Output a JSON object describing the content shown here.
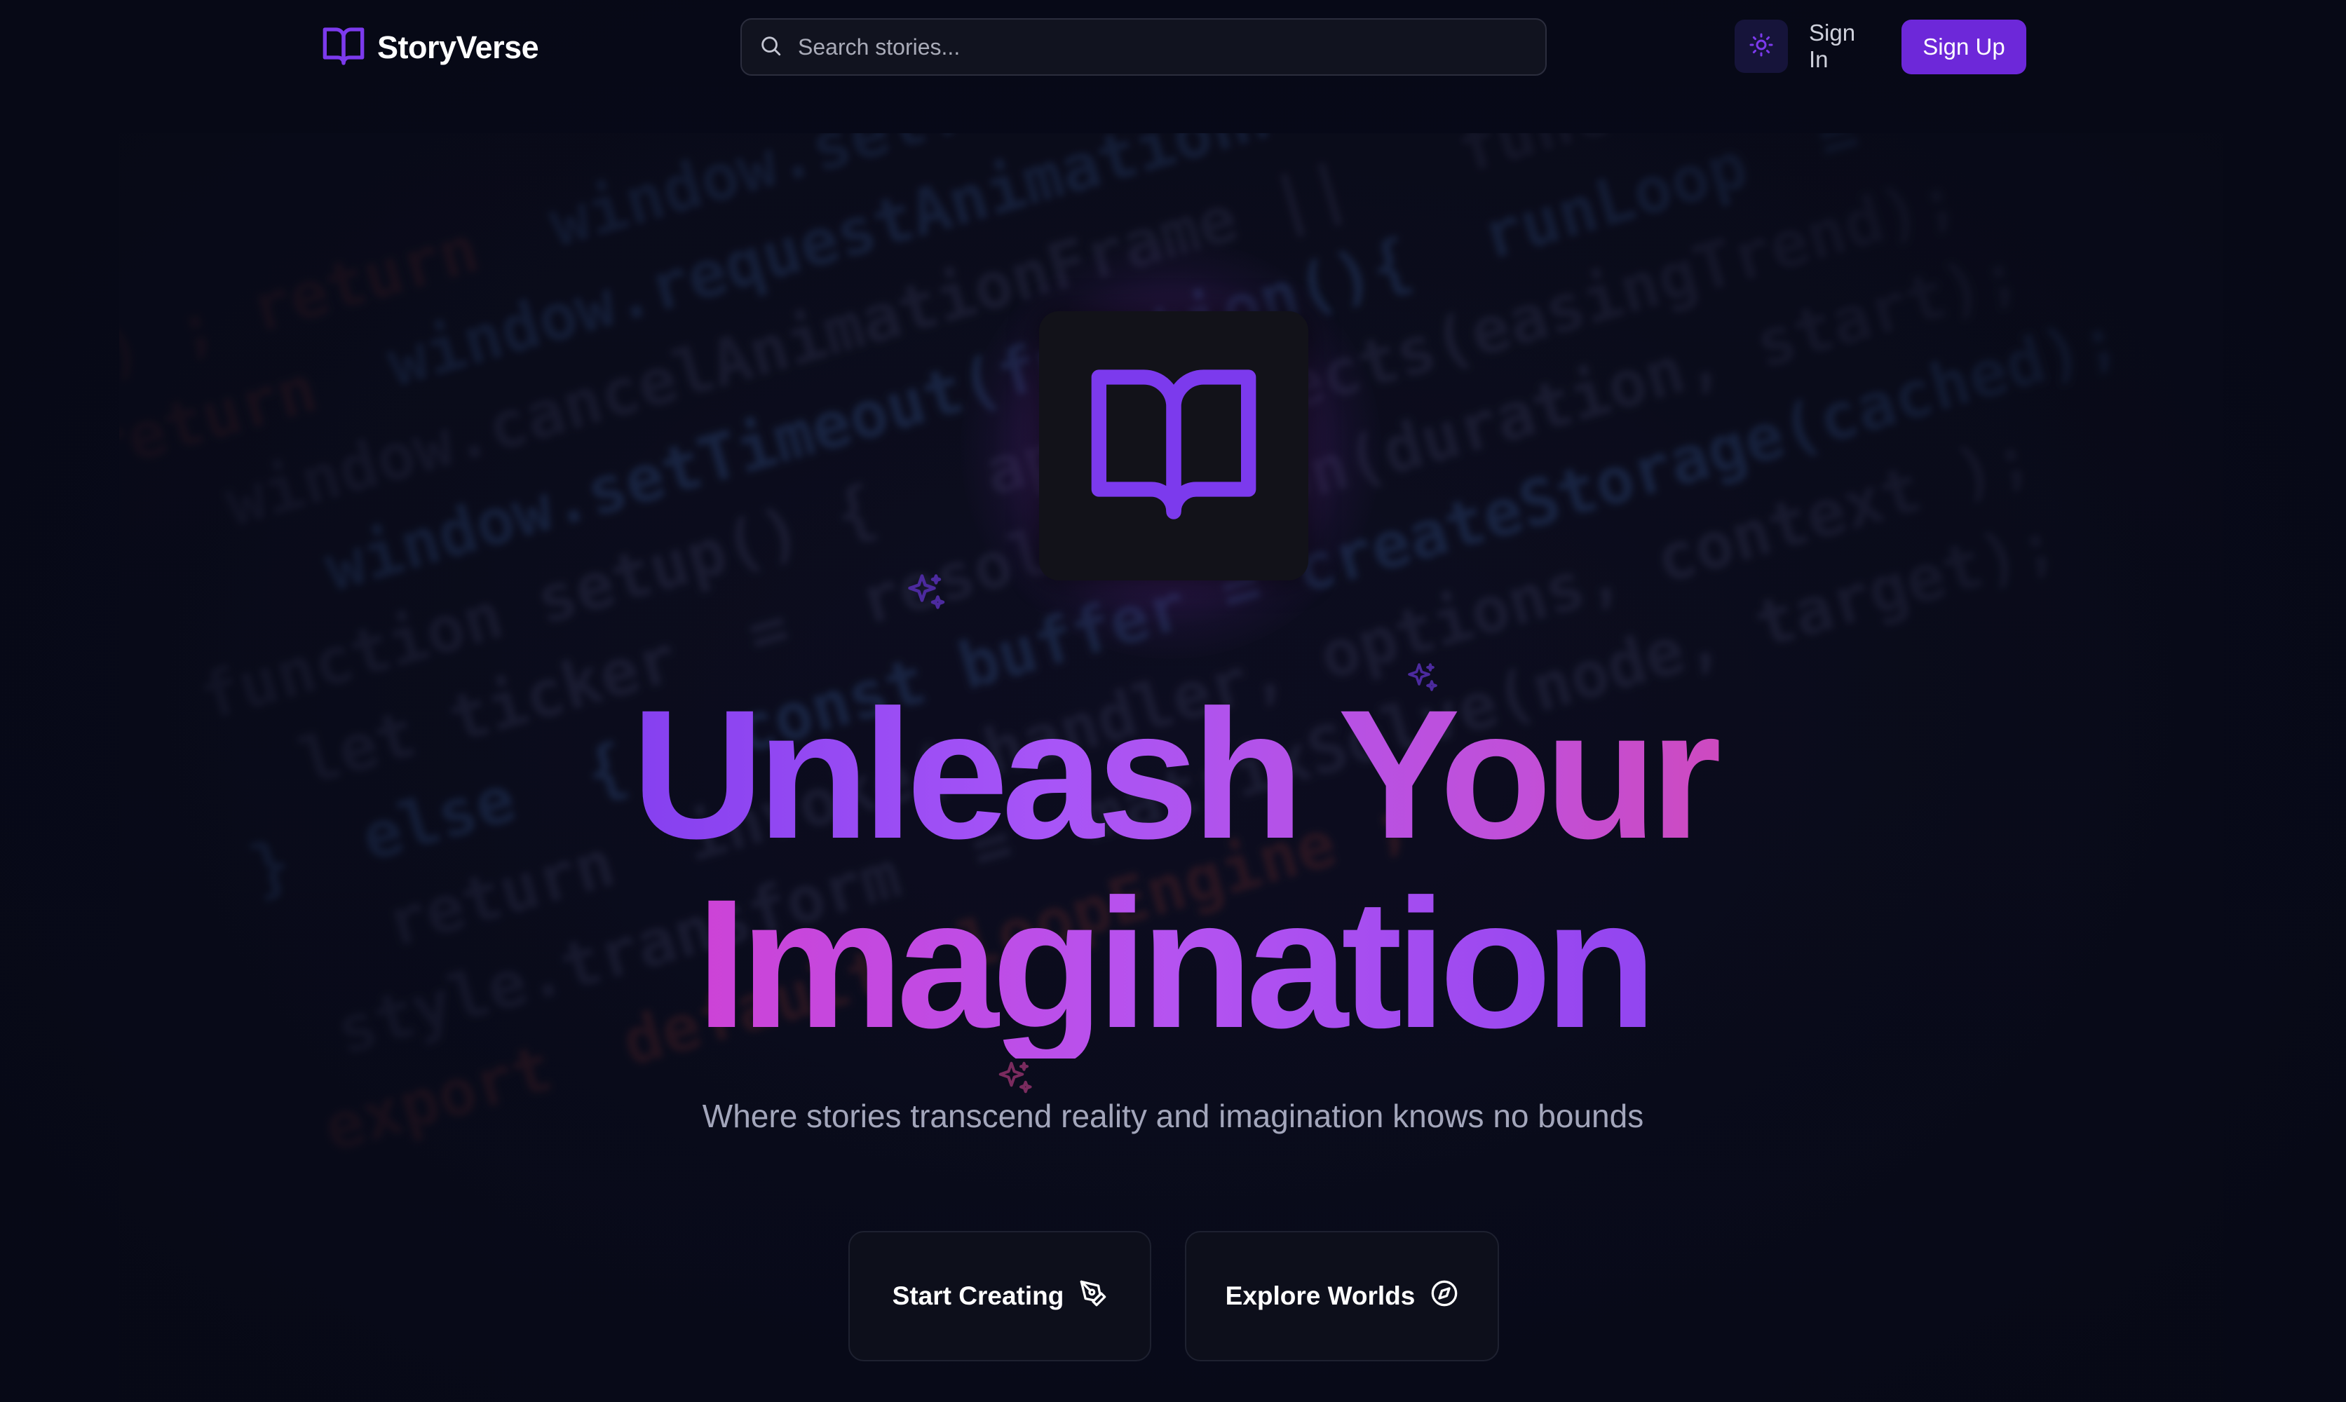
{
  "colors": {
    "background": "#080a18",
    "accent": "#6d28d9",
    "accent_light": "#7c3aed",
    "pink": "#ec4899",
    "text_muted": "#a3a6bb"
  },
  "header": {
    "logo_icon": "book-open-icon",
    "brand": "StoryVerse",
    "search": {
      "icon": "search-icon",
      "placeholder": "Search stories...",
      "value": ""
    },
    "theme_toggle_icon": "sun-icon",
    "sign_in_label": "Sign In",
    "sign_up_label": "Sign Up"
  },
  "hero": {
    "icon": "book-open-icon",
    "sparkle_icon": "sparkles-icon",
    "headline_line1": "Unleash Your",
    "headline_line2": "Imagination",
    "subtitle": "Where stories transcend reality and imagination knows no bounds",
    "primary_cta": {
      "label": "Start Creating",
      "icon": "pen-tool-icon"
    },
    "secondary_cta": {
      "label": "Explore Worlds",
      "icon": "compass-icon"
    }
  }
}
